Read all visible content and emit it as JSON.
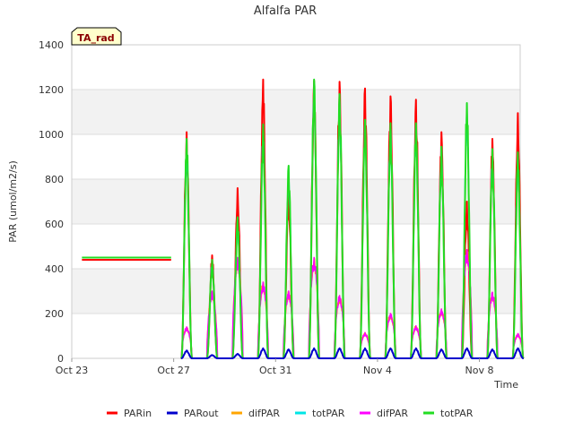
{
  "chart_data": {
    "type": "line",
    "title": "Alfalfa PAR",
    "xlabel": "Time",
    "ylabel": "PAR (umol/m2/s)",
    "badge": "TA_rad",
    "ylim": [
      0,
      1400
    ],
    "xlim_days": [
      "Oct 23",
      "Nov 9.6"
    ],
    "y_ticks": [
      "0",
      "200",
      "400",
      "600",
      "800",
      "1000",
      "1200",
      "1400"
    ],
    "x_ticks": [
      "Oct 23",
      "Oct 27",
      "Oct 31",
      "Nov 4",
      "Nov 8"
    ],
    "grid": "horizontal bands",
    "legend_position": "bottom",
    "baseline": {
      "x": [
        "Oct 23.4",
        "Oct 26.9"
      ],
      "series": [
        {
          "name": "PARin",
          "value": 440
        },
        {
          "name": "totPAR",
          "value": 450
        }
      ]
    },
    "days": [
      {
        "date": "Oct 27",
        "PARin": 1010,
        "PARout": 35,
        "difPAR": 140,
        "totPAR": 980
      },
      {
        "date": "Oct 28",
        "PARin": 460,
        "PARout": 15,
        "difPAR": 300,
        "totPAR": 440
      },
      {
        "date": "Oct 29",
        "PARin": 760,
        "PARout": 20,
        "difPAR": 450,
        "totPAR": 630
      },
      {
        "date": "Oct 30",
        "PARin": 1245,
        "PARout": 45,
        "difPAR": 340,
        "totPAR": 1045
      },
      {
        "date": "Oct 31",
        "PARin": 750,
        "PARout": 40,
        "difPAR": 300,
        "totPAR": 860
      },
      {
        "date": "Nov 1",
        "PARin": 1240,
        "PARout": 45,
        "difPAR": 450,
        "totPAR": 1245
      },
      {
        "date": "Nov 2",
        "PARin": 1235,
        "PARout": 45,
        "difPAR": 280,
        "totPAR": 1180
      },
      {
        "date": "Nov 3",
        "PARin": 1205,
        "PARout": 45,
        "difPAR": 115,
        "totPAR": 1065
      },
      {
        "date": "Nov 4",
        "PARin": 1170,
        "PARout": 45,
        "difPAR": 200,
        "totPAR": 1050
      },
      {
        "date": "Nov 5",
        "PARin": 1155,
        "PARout": 45,
        "difPAR": 145,
        "totPAR": 1050
      },
      {
        "date": "Nov 6",
        "PARin": 1010,
        "PARout": 40,
        "difPAR": 220,
        "totPAR": 945
      },
      {
        "date": "Nov 7",
        "PARin": 700,
        "PARout": 45,
        "difPAR": 485,
        "totPAR": 1140
      },
      {
        "date": "Nov 8",
        "PARin": 980,
        "PARout": 40,
        "difPAR": 295,
        "totPAR": 935
      },
      {
        "date": "Nov 9",
        "PARin": 1095,
        "PARout": 45,
        "difPAR": 110,
        "totPAR": 920
      }
    ],
    "series": [
      {
        "name": "PARin",
        "color": "#ff0000"
      },
      {
        "name": "PARout",
        "color": "#0000cc"
      },
      {
        "name": "difPAR",
        "color": "#ffa500"
      },
      {
        "name": "totPAR",
        "color": "#00e5e5"
      },
      {
        "name": "difPAR",
        "color": "#ff00ff"
      },
      {
        "name": "totPAR",
        "color": "#22dd22"
      }
    ]
  }
}
